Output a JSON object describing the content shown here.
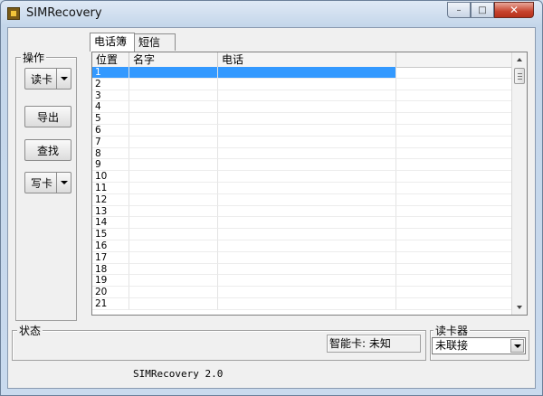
{
  "window": {
    "title": "SIMRecovery",
    "minimize_glyph": "–",
    "maximize_glyph": "□",
    "close_glyph": "✕",
    "accent_close": "#c7432d",
    "icon": "sim-card-icon"
  },
  "operations": {
    "group_label": "操作",
    "read_card_label": "读卡",
    "export_label": "导出",
    "find_label": "查找",
    "write_card_label": "写卡"
  },
  "tabs": [
    {
      "label": "电话簿",
      "active": true
    },
    {
      "label": "短信",
      "active": false
    }
  ],
  "table": {
    "columns": [
      "位置",
      "名字",
      "电话"
    ],
    "rows": [
      {
        "position": "1",
        "name": "",
        "phone": "",
        "selected": true
      },
      {
        "position": "2",
        "name": "",
        "phone": "",
        "selected": false
      },
      {
        "position": "3",
        "name": "",
        "phone": "",
        "selected": false
      },
      {
        "position": "4",
        "name": "",
        "phone": "",
        "selected": false
      },
      {
        "position": "5",
        "name": "",
        "phone": "",
        "selected": false
      },
      {
        "position": "6",
        "name": "",
        "phone": "",
        "selected": false
      },
      {
        "position": "7",
        "name": "",
        "phone": "",
        "selected": false
      },
      {
        "position": "8",
        "name": "",
        "phone": "",
        "selected": false
      },
      {
        "position": "9",
        "name": "",
        "phone": "",
        "selected": false
      },
      {
        "position": "10",
        "name": "",
        "phone": "",
        "selected": false
      },
      {
        "position": "11",
        "name": "",
        "phone": "",
        "selected": false
      },
      {
        "position": "12",
        "name": "",
        "phone": "",
        "selected": false
      },
      {
        "position": "13",
        "name": "",
        "phone": "",
        "selected": false
      },
      {
        "position": "14",
        "name": "",
        "phone": "",
        "selected": false
      },
      {
        "position": "15",
        "name": "",
        "phone": "",
        "selected": false
      },
      {
        "position": "16",
        "name": "",
        "phone": "",
        "selected": false
      },
      {
        "position": "17",
        "name": "",
        "phone": "",
        "selected": false
      },
      {
        "position": "18",
        "name": "",
        "phone": "",
        "selected": false
      },
      {
        "position": "19",
        "name": "",
        "phone": "",
        "selected": false
      },
      {
        "position": "20",
        "name": "",
        "phone": "",
        "selected": false
      },
      {
        "position": "21",
        "name": "",
        "phone": "",
        "selected": false
      }
    ],
    "selection_color": "#3399ff"
  },
  "status": {
    "group_label": "状态",
    "smart_card_text": "智能卡: 未知"
  },
  "reader": {
    "group_label": "读卡器",
    "selected_value": "未联接"
  },
  "footer": {
    "version_text": "SIMRecovery 2.0"
  }
}
